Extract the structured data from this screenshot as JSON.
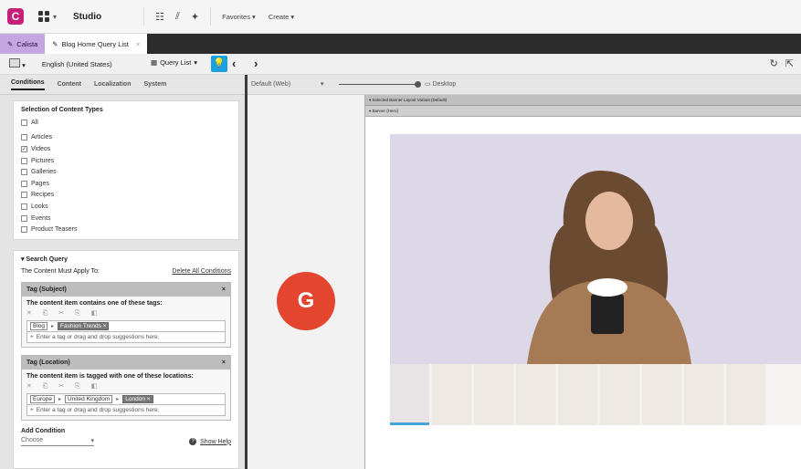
{
  "topbar": {
    "app_name": "Studio",
    "menus": [
      "Favorites",
      "Create"
    ]
  },
  "tabs": [
    {
      "label": "Calista"
    },
    {
      "label": "Blog Home Query List"
    }
  ],
  "toolbar": {
    "locale": "English (United States)",
    "view": "Query List"
  },
  "subtabs": [
    "Conditions",
    "Content",
    "Localization",
    "System"
  ],
  "content_types": {
    "title": "Selection of Content Types",
    "items": [
      {
        "label": "All",
        "checked": false
      },
      {
        "label": "Articles",
        "checked": false
      },
      {
        "label": "Videos",
        "checked": true
      },
      {
        "label": "Pictures",
        "checked": false
      },
      {
        "label": "Galleries",
        "checked": false
      },
      {
        "label": "Pages",
        "checked": false
      },
      {
        "label": "Recipes",
        "checked": false
      },
      {
        "label": "Looks",
        "checked": false
      },
      {
        "label": "Events",
        "checked": false
      },
      {
        "label": "Product Teasers",
        "checked": false
      }
    ]
  },
  "search": {
    "title": "Search Query",
    "apply_label": "The Content Must Apply To:",
    "delete_all": "Delete All Conditions",
    "subject": {
      "header": "Tag (Subject)",
      "desc": "The content item contains one of these tags:",
      "path": [
        "Blog",
        "Fashion Trends"
      ],
      "placeholder": "Enter a tag or drag and drop suggestions here."
    },
    "location": {
      "header": "Tag (Location)",
      "desc": "The content item is tagged with one of these locations:",
      "path": [
        "Europe",
        "United Kingdom",
        "London"
      ],
      "placeholder": "Enter a tag or drag and drop suggestions here."
    },
    "add_condition": "Add Condition",
    "choose": "Choose",
    "show_help": "Show Help"
  },
  "device": {
    "channel": "Default (Web)",
    "mode": "Desktop"
  },
  "preview": {
    "bar1": "Selected Banner Layout Variant (Default)",
    "bar2": "Banner (Hero)"
  },
  "badge": "G"
}
